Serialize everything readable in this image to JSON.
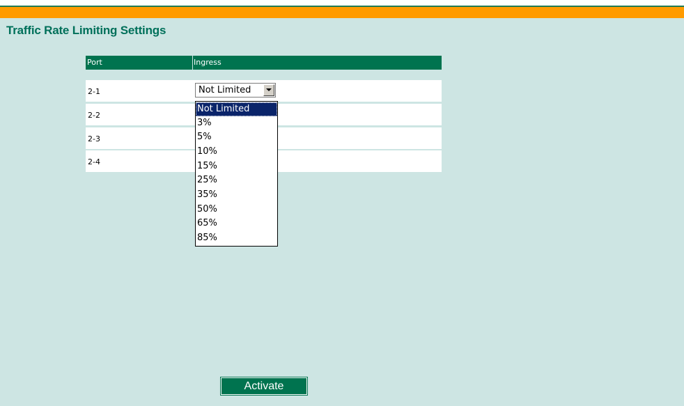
{
  "page": {
    "title": "Traffic Rate Limiting Settings"
  },
  "colors": {
    "background": "#cde5e3",
    "accent_orange": "#ff9b00",
    "brand_green": "#00734f",
    "title_green": "#00705a",
    "selection_blue": "#0a246a"
  },
  "table": {
    "columns": [
      "Port",
      "Ingress"
    ],
    "rows": [
      {
        "port": "2-1",
        "ingress": "Not Limited"
      },
      {
        "port": "2-2",
        "ingress": ""
      },
      {
        "port": "2-3",
        "ingress": ""
      },
      {
        "port": "2-4",
        "ingress": ""
      }
    ]
  },
  "dropdown": {
    "selected": "Not Limited",
    "arrow_icon": "chevron-down-icon",
    "options": [
      "Not Limited",
      "3%",
      "5%",
      "10%",
      "15%",
      "25%",
      "35%",
      "50%",
      "65%",
      "85%"
    ]
  },
  "actions": {
    "activate_label": "Activate"
  }
}
